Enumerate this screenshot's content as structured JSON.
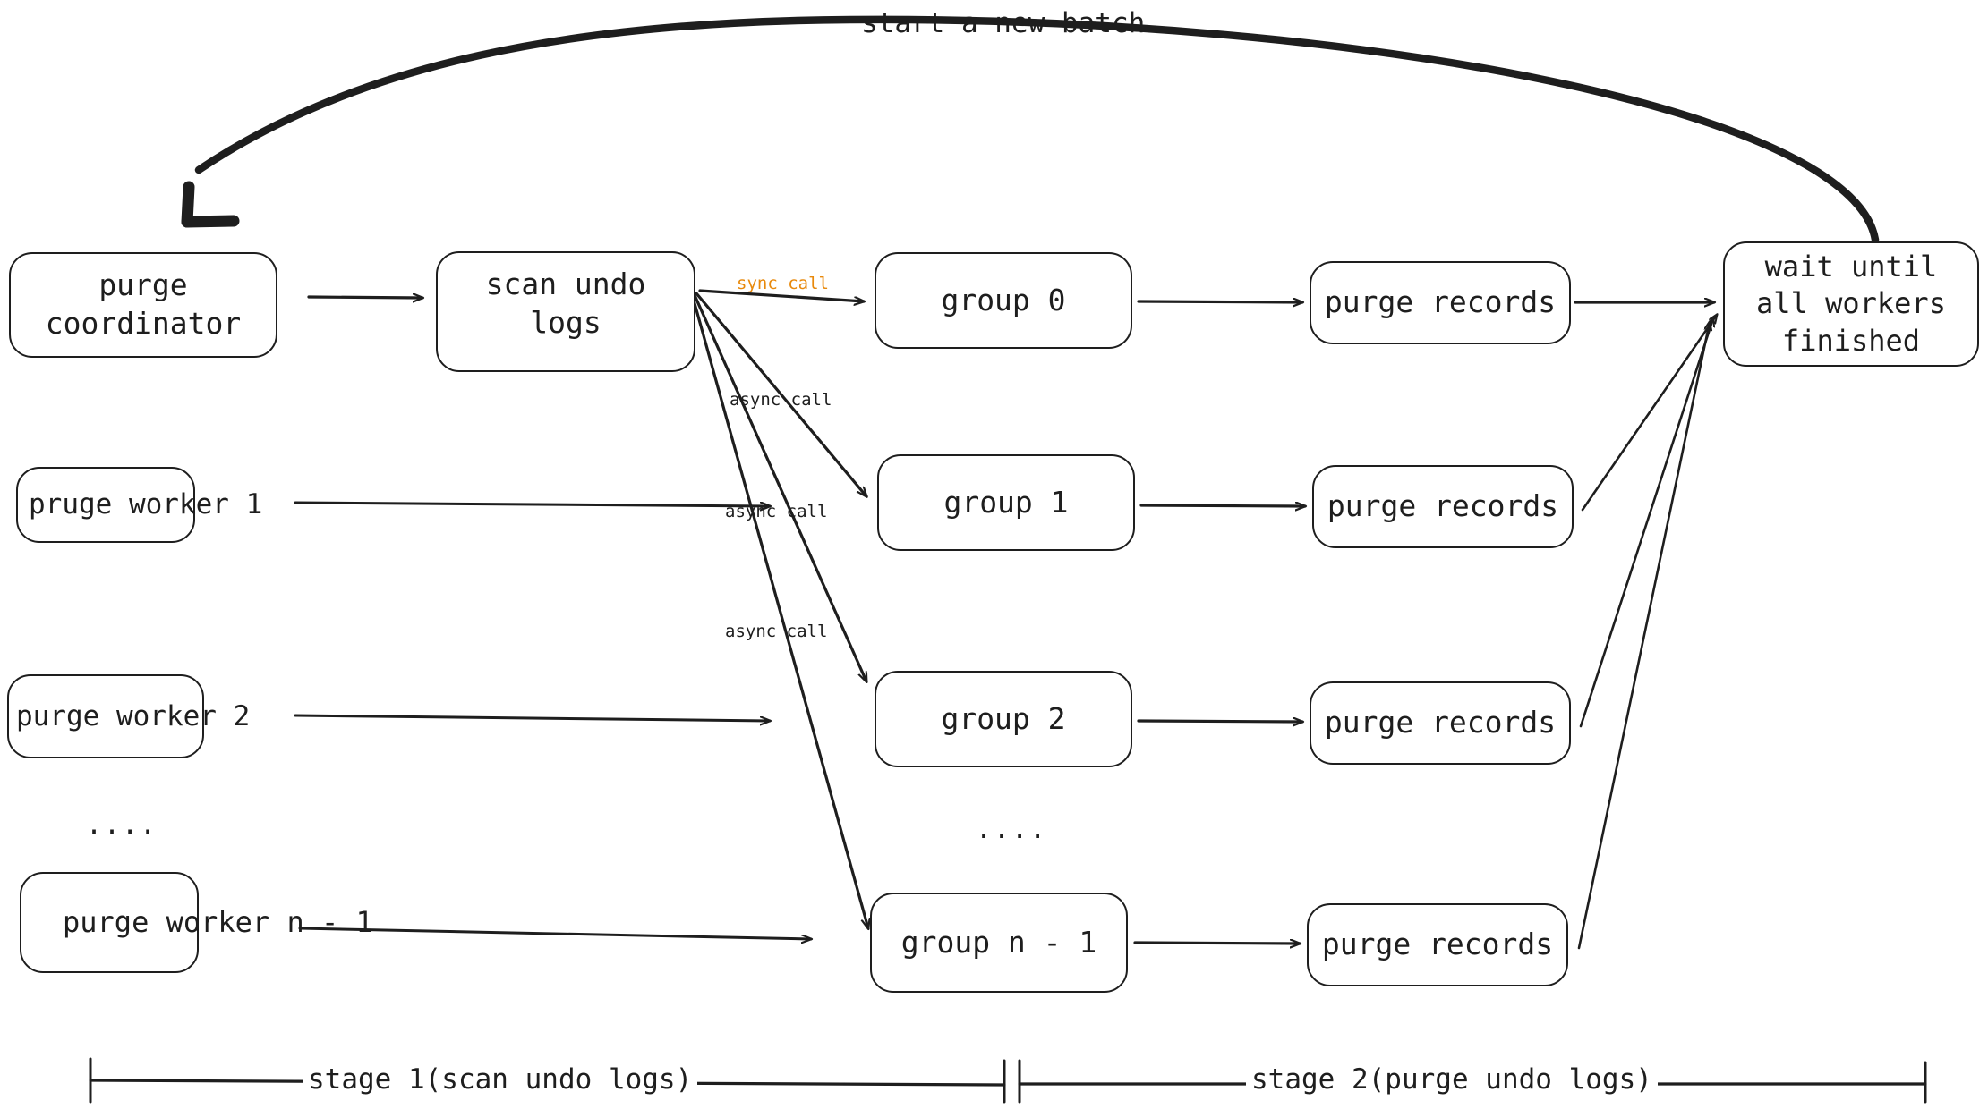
{
  "diagram": {
    "title_text": "start a new batch",
    "accent_color": "#e8890c",
    "stroke_color": "#1e1e1e",
    "background": "#ffffff"
  },
  "nodes": {
    "coordinator": {
      "label": "purge\ncoordinator"
    },
    "scan_undo_logs": {
      "label": "scan undo\nlogs"
    },
    "workers": [
      {
        "label": "pruge worker 1"
      },
      {
        "label": "purge worker 2"
      },
      {
        "label": "purge worker n - 1"
      }
    ],
    "worker_ellipsis": "....",
    "groups": [
      {
        "label": "group 0"
      },
      {
        "label": "group 1"
      },
      {
        "label": "group 2"
      },
      {
        "label": "group n - 1"
      }
    ],
    "group_ellipsis": "....",
    "purge_records": [
      {
        "label": "purge records"
      },
      {
        "label": "purge records"
      },
      {
        "label": "purge records"
      },
      {
        "label": "purge records"
      }
    ],
    "wait_box": {
      "label": "wait until\nall workers\nfinished"
    }
  },
  "edge_labels": {
    "sync_call": "sync call",
    "async_calls": [
      "async call",
      "async call",
      "async call"
    ]
  },
  "stages": [
    {
      "label": "stage 1(scan undo logs)"
    },
    {
      "label": "stage 2(purge undo logs)"
    }
  ]
}
